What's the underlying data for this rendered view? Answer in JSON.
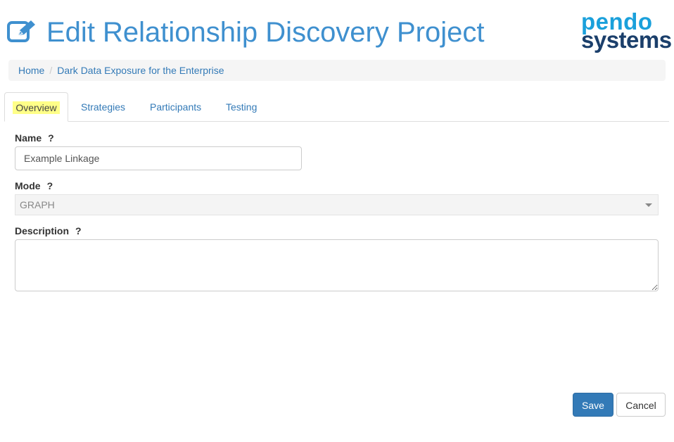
{
  "header": {
    "title": "Edit Relationship Discovery Project",
    "title_icon": "edit-icon",
    "logo": {
      "line1": "pendo",
      "line2": "systems",
      "color_primary": "#1aa0db",
      "color_secondary": "#1b3f6b"
    }
  },
  "breadcrumb": {
    "items": [
      "Home",
      "Dark Data Exposure for the Enterprise"
    ],
    "separator": "/"
  },
  "tabs": [
    {
      "label": "Overview",
      "active": true
    },
    {
      "label": "Strategies",
      "active": false
    },
    {
      "label": "Participants",
      "active": false
    },
    {
      "label": "Testing",
      "active": false
    }
  ],
  "form": {
    "name": {
      "label": "Name",
      "help": "?",
      "value": "Example Linkage"
    },
    "mode": {
      "label": "Mode",
      "help": "?",
      "value": "GRAPH",
      "disabled": true
    },
    "description": {
      "label": "Description",
      "help": "?",
      "value": ""
    }
  },
  "actions": {
    "save_label": "Save",
    "cancel_label": "Cancel"
  },
  "colors": {
    "accent": "#3f90cf",
    "link": "#337ab7",
    "primary_button": "#337ab7",
    "tab_highlight": "#ffff88"
  }
}
